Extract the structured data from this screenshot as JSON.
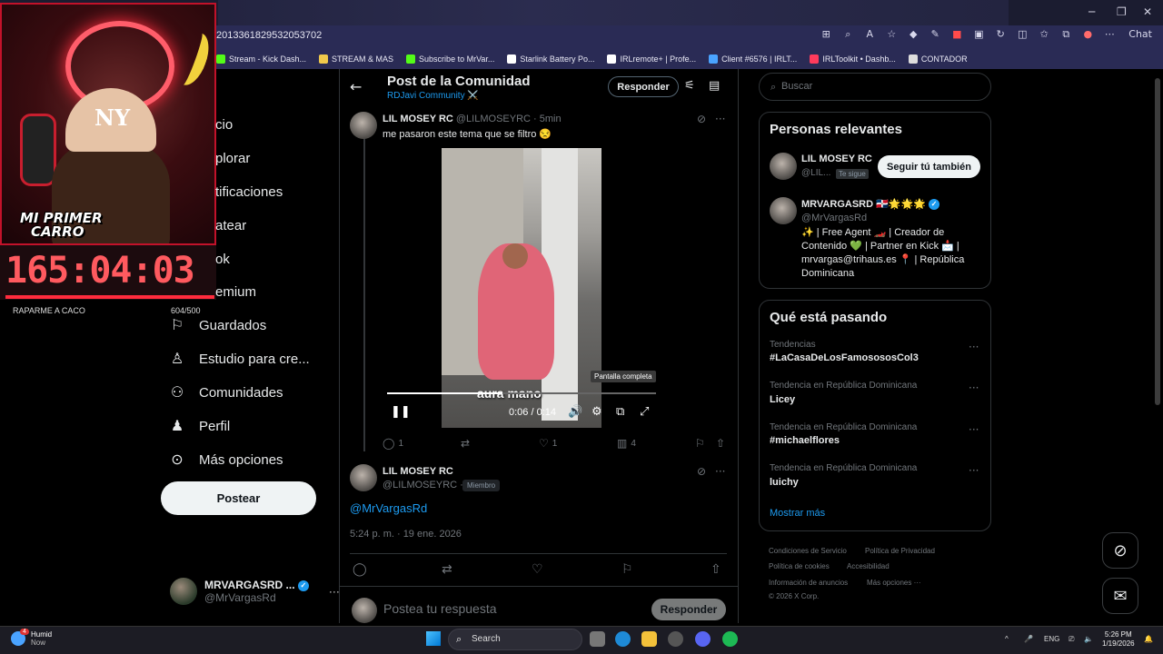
{
  "browser": {
    "url": "2013361829532053702",
    "chat_label": "Chat",
    "bookmarks": [
      {
        "label": "Stream - Kick Dash...",
        "color": "#53fc18"
      },
      {
        "label": "STREAM & MAS",
        "color": "#f0c94b"
      },
      {
        "label": "Subscribe to MrVar...",
        "color": "#53fc18"
      },
      {
        "label": "Starlink Battery Po...",
        "color": "#ffffff"
      },
      {
        "label": "IRLremote+ | Profe...",
        "color": "#ffffff"
      },
      {
        "label": "Client #6576 | IRLT...",
        "color": "#4aa3ff"
      },
      {
        "label": "IRLToolkit • Dashb...",
        "color": "#ff3b5c"
      },
      {
        "label": "CONTADOR",
        "color": "#dddddd"
      }
    ]
  },
  "overlay": {
    "sticker_line1": "MI PRIMER",
    "sticker_line2": "CARRO",
    "cap_text": "NY",
    "timer": "165:04:03",
    "goal_label": "RAPARME A CACO",
    "goal_count": "604/500",
    "goal_progress": 1.0
  },
  "nav": {
    "partial_items": [
      "cio",
      "plorar",
      "tificaciones",
      "atear",
      "ok",
      "emium"
    ],
    "items": [
      {
        "label": "Guardados",
        "icon": "bookmark-icon"
      },
      {
        "label": "Estudio para cre...",
        "icon": "flask-icon"
      },
      {
        "label": "Comunidades",
        "icon": "people-icon"
      },
      {
        "label": "Perfil",
        "icon": "person-icon"
      },
      {
        "label": "Más opciones",
        "icon": "more-circle-icon"
      }
    ],
    "post_button": "Postear",
    "account": {
      "name": "MRVARGASRD ...",
      "handle": "@MrVargasRd"
    }
  },
  "header": {
    "title": "Post de la Comunidad",
    "community": "RDJavi Community ⚔️",
    "reply_button": "Responder"
  },
  "tweet1": {
    "name": "LIL MOSEY RC",
    "handle": "@LILMOSEYRC · 5min",
    "text": "me pasaron este tema que se filtro 😒",
    "video": {
      "caption": "aura mano",
      "tooltip": "Pantalla completa",
      "time": "0:06 / 0:14",
      "progress": 0.43
    },
    "stats": {
      "replies": "1",
      "retweets": "",
      "likes": "1",
      "views": "4"
    }
  },
  "tweet2": {
    "name": "LIL MOSEY RC",
    "handle": "@LILMOSEYRC ·",
    "badge": "Miembro",
    "mention": "@MrVargasRd",
    "datetime": "5:24 p. m. · 19 ene. 2026"
  },
  "reply_bar": {
    "placeholder": "Postea tu respuesta",
    "button": "Responder"
  },
  "search": {
    "placeholder": "Buscar"
  },
  "relevant": {
    "title": "Personas relevantes",
    "person1": {
      "name": "LIL MOSEY RC",
      "handle": "@LIL...",
      "tag": "Te sigue",
      "button": "Seguir tú también"
    },
    "person2": {
      "name": "MRVARGASRD 🇩🇴🌟🌟🌟",
      "handle": "@MrVargasRd",
      "bio": "✨ | Free Agent 🏎️ | Creador de Contenido 💚 | Partner en Kick 📩 | mrvargas@trihaus.es 📍 | República Dominicana"
    }
  },
  "trends": {
    "title": "Qué está pasando",
    "items": [
      {
        "context": "Tendencias",
        "name": "#LaCasaDeLosFamosososCol3"
      },
      {
        "context": "Tendencia en República Dominicana",
        "name": "Licey"
      },
      {
        "context": "Tendencia en República Dominicana",
        "name": "#michaelflores"
      },
      {
        "context": "Tendencia en República Dominicana",
        "name": "luichy"
      }
    ],
    "show_more": "Mostrar más"
  },
  "footer": {
    "links": [
      "Condiciones de Servicio",
      "Política de Privacidad",
      "Política de cookies",
      "Accesibilidad",
      "Información de anuncios",
      "Más opciones ···"
    ],
    "copyright": "© 2026 X Corp."
  },
  "taskbar": {
    "weather_temp": "Humid",
    "weather_sub": "Now",
    "weather_badge": "4",
    "search": "Search",
    "lang": "ENG",
    "time": "5:26 PM",
    "date": "1/19/2026"
  }
}
